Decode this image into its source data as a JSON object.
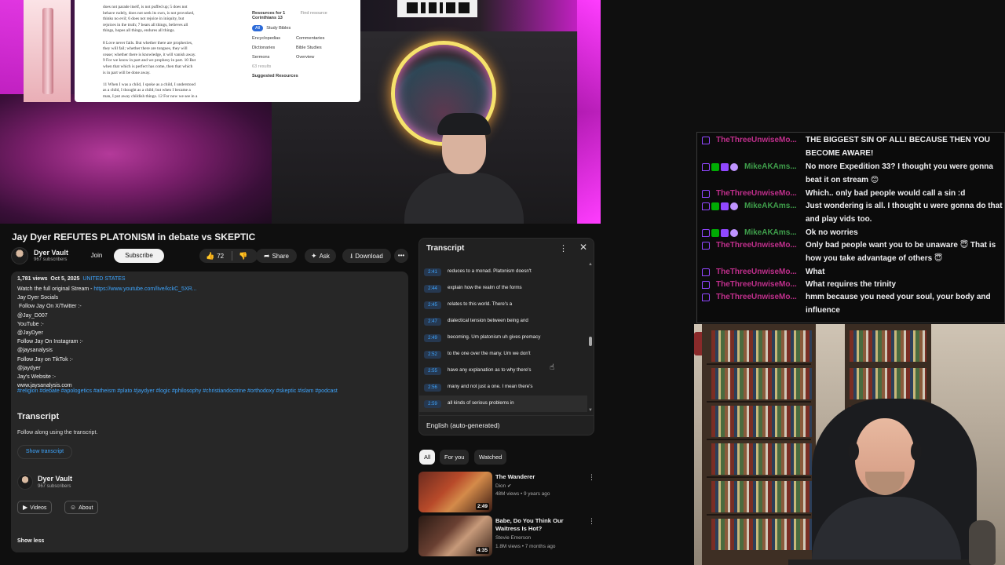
{
  "video": {
    "doc": {
      "lines": [
        "does not parade itself, is not puffed up; 5 does not",
        "behave rudely, does not seek its own, is not provoked,",
        "thinks no evil; 6 does not rejoice in iniquity, but",
        "rejoices in the truth; 7 bears all things, believes all",
        "things, hopes all things, endures all things.",
        "",
        "8 Love never fails. But whether there are prophecies,",
        "they will fail; whether there are tongues, they will",
        "cease; whether there is knowledge, it will vanish away.",
        "9 For we know in part and we prophesy in part. 10 But",
        "when that which is perfect has come, then that which",
        "is in part will be done away.",
        "",
        "11 When I was a child, I spoke as a child, I understood",
        "as a child, I thought as a child; but when I became a",
        "man, I put away childish things. 12 For now we see in a"
      ],
      "side": {
        "resources": "Resources for 1 Corinthians 13",
        "find": "Find resource",
        "all": "All",
        "study_bibles": "Study Bibles",
        "encyclopedias": "Encyclopedias",
        "commentaries": "Commentaries",
        "dictionaries": "Dictionaries",
        "bible_studies": "Bible Studies",
        "sermons": "Sermons",
        "overview": "Overview",
        "results": "63 results",
        "suggested": "Suggested Resources"
      }
    }
  },
  "title": "Jay Dyer REFUTES PLATONISM in debate vs SKEPTIC",
  "channel": {
    "name": "Dyer Vault",
    "subs": "967 subscribers"
  },
  "actions": {
    "join": "Join",
    "subscribe": "Subscribe",
    "likes": "72",
    "share": "Share",
    "ask": "Ask",
    "download": "Download"
  },
  "description": {
    "views": "1,781 views",
    "date": "Oct 5, 2025",
    "location": "UNITED STATES",
    "stream_prefix": "Watch the full original Stream - ",
    "stream_link": "https://www.youtube.com/live/kckC_5XR...",
    "lines": [
      "Jay Dyer Socials",
      " Follow Jay On X/Twitter :-",
      "@Jay_D007",
      "YouTube :-",
      "@JayDyer",
      "Follow Jay On Instagram :-",
      "@jaysanalysis",
      "Follow Jay on TikTok :-",
      "@jaydyer",
      "Jay's Website :-",
      "www.jaysanalysis.com"
    ],
    "tags": "#religion #debate #apologetics #atheism #plato #jaydyer #logic #philosophy #christiandoctrine #orthodoxy #skeptic #islam #podcast",
    "transcript_heading": "Transcript",
    "transcript_sub": "Follow along using the transcript.",
    "show_transcript": "Show transcript",
    "channel_name": "Dyer Vault",
    "channel_subs": "967 subscribers",
    "videos": "Videos",
    "about": "About",
    "show_less": "Show less"
  },
  "transcript": {
    "title": "Transcript",
    "language": "English (auto-generated)",
    "segments": [
      {
        "t": "2:41",
        "text": "reduces to a monad. Platonism doesn't"
      },
      {
        "t": "2:44",
        "text": "explain how the realm of the forms"
      },
      {
        "t": "2:45",
        "text": "relates to this world. There's a"
      },
      {
        "t": "2:47",
        "text": "dialectical tension between being and"
      },
      {
        "t": "2:49",
        "text": "becoming. Um platonism uh gives premacy"
      },
      {
        "t": "2:52",
        "text": "to the one over the many. Um we don't"
      },
      {
        "t": "2:55",
        "text": "have any explanation as to why there's"
      },
      {
        "t": "2:56",
        "text": "many and not just a one. I mean there's"
      },
      {
        "t": "2:59",
        "text": "all kinds of serious problems in"
      }
    ]
  },
  "chips": [
    "All",
    "For you",
    "Watched"
  ],
  "recommendations": [
    {
      "title": "The Wanderer",
      "channel": "Dion",
      "meta": "48M views • 9 years ago",
      "duration": "2:49"
    },
    {
      "title": "Babe, Do You Think Our Waitress Is Hot?",
      "channel": "Stevie Emerson",
      "meta": "1.8M views • 7 months ago",
      "duration": "4:35"
    }
  ],
  "chat": [
    {
      "user": "TheThreeUnwiseMo...",
      "kind": "u1",
      "badges": [
        "mod"
      ],
      "text": "THE BIGGEST SIN OF ALL! BECAUSE THEN YOU BECOME AWARE!"
    },
    {
      "user": "MikeAKAms...",
      "kind": "u2",
      "badges": [
        "mod",
        "check",
        "star",
        "prime"
      ],
      "text": "No more Expedition 33? I thought you were gonna beat it on stream 😊"
    },
    {
      "user": "TheThreeUnwiseMo...",
      "kind": "u1",
      "badges": [
        "mod"
      ],
      "text": "Which.. only bad people would call a sin :d"
    },
    {
      "user": "MikeAKAms...",
      "kind": "u2",
      "badges": [
        "mod",
        "check",
        "star",
        "prime"
      ],
      "text": "Just wondering is all. I thought u were gonna do that and play vids too."
    },
    {
      "user": "MikeAKAms...",
      "kind": "u2",
      "badges": [
        "mod",
        "check",
        "star",
        "prime"
      ],
      "text": "Ok no worries"
    },
    {
      "user": "TheThreeUnwiseMo...",
      "kind": "u1",
      "badges": [
        "mod"
      ],
      "text": "Only bad people want you to be unaware 😇 That is how you take advantage of others 😇"
    },
    {
      "user": "TheThreeUnwiseMo...",
      "kind": "u1",
      "badges": [
        "mod"
      ],
      "text": "What"
    },
    {
      "user": "TheThreeUnwiseMo...",
      "kind": "u1",
      "badges": [
        "mod"
      ],
      "text": "What requires the trinity"
    },
    {
      "user": "TheThreeUnwiseMo...",
      "kind": "u1",
      "badges": [
        "mod"
      ],
      "text": "hmm because you need your soul, your body and influence"
    }
  ],
  "colors": {
    "accent_blue": "#3ea6ff",
    "chat_user_a": "#c02f8c",
    "chat_user_b": "#3f9f4b",
    "twitch_purple": "#9147ff"
  }
}
